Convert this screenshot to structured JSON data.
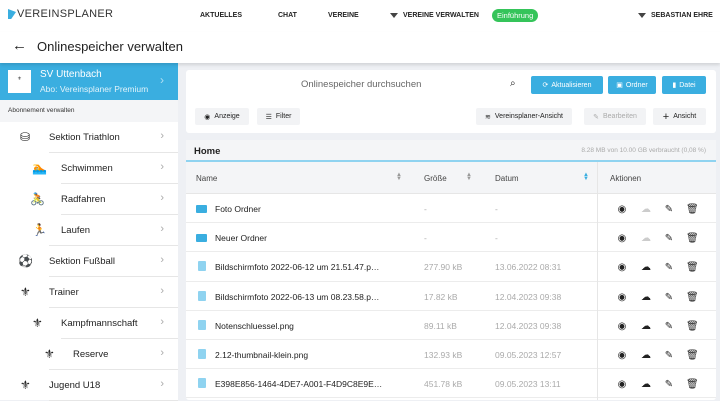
{
  "topbar": {
    "logo": "VEREINSPLANER",
    "nav": [
      "AKTUELLES",
      "CHAT",
      "VEREINE",
      "VEREINE VERWALTEN"
    ],
    "badge": "Einführung",
    "user": "SEBASTIAN EHRE"
  },
  "page": {
    "title": "Onlinespeicher verwalten",
    "back_icon": "←"
  },
  "sidebar": {
    "club_name": "SV Uttenbach",
    "club_sub": "Abo: Vereinsplaner Premium",
    "abo_link": "Abonnement verwalten",
    "items": [
      {
        "label": "Sektion Triathlon",
        "icon": "⛁"
      },
      {
        "label": "Schwimmen",
        "icon": "🏊"
      },
      {
        "label": "Radfahren",
        "icon": "🚴"
      },
      {
        "label": "Laufen",
        "icon": "🏃"
      },
      {
        "label": "Sektion Fußball",
        "icon": "⚽"
      },
      {
        "label": "Trainer",
        "icon": "⚜"
      },
      {
        "label": "Kampfmannschaft",
        "icon": "⚜"
      },
      {
        "label": "Reserve",
        "icon": "⚜"
      },
      {
        "label": "Jugend U18",
        "icon": "⚜"
      }
    ]
  },
  "search": {
    "placeholder": "Onlinespeicher durchsuchen",
    "refresh": "Aktualisieren",
    "folder": "Ordner",
    "file": "Datei"
  },
  "toolbar": {
    "view": "Anzeige",
    "filter": "Filter",
    "vp_view": "Vereinsplaner-Ansicht",
    "edit": "Bearbeiten",
    "add_view": "Ansicht"
  },
  "files": {
    "title": "Home",
    "usage": "8.28 MB von 10.00 GB verbraucht   (0,08 %)",
    "columns": {
      "name": "Name",
      "size": "Größe",
      "date": "Datum",
      "actions": "Aktionen"
    },
    "rows": [
      {
        "name": "Foto Ordner",
        "size": "-",
        "date": "-",
        "type": "folder"
      },
      {
        "name": "Neuer Ordner",
        "size": "-",
        "date": "-",
        "type": "folder"
      },
      {
        "name": "Bildschirmfoto 2022-06-12 um 21.51.47.p…",
        "size": "277.90 kB",
        "date": "13.06.2022 08:31",
        "type": "image"
      },
      {
        "name": "Bildschirmfoto 2022-06-13 um 08.23.58.p…",
        "size": "17.82 kB",
        "date": "12.04.2023 09:38",
        "type": "image"
      },
      {
        "name": "Notenschluessel.png",
        "size": "89.11 kB",
        "date": "12.04.2023 09:38",
        "type": "image"
      },
      {
        "name": "2.12-thumbnail-klein.png",
        "size": "132.93 kB",
        "date": "09.05.2023 12:57",
        "type": "image"
      },
      {
        "name": "E398E856-1464-4DE7-A001-F4D9C8E9E…",
        "size": "451.78 kB",
        "date": "09.05.2023 13:11",
        "type": "image"
      }
    ]
  },
  "colors": {
    "accent": "#3aaee0",
    "badge": "#35c45a"
  }
}
